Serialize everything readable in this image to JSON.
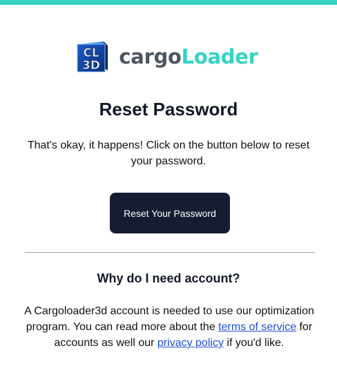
{
  "brand": {
    "logo_mark_line1": "CL",
    "logo_mark_line2": "3D",
    "name_part1": "cargo",
    "name_part2": "Loader",
    "accent_color": "#35d3c4",
    "dark_text_color": "#4d5560"
  },
  "header": {
    "title": "Reset Password",
    "intro": "That's okay, it happens! Click on the button below to reset your password."
  },
  "cta": {
    "label": "Reset Your Password",
    "background_color": "#161d33"
  },
  "info": {
    "heading": "Why do I need account?",
    "text_1": "A Cargoloader3d account is needed to use our optimization program. You can read more about the ",
    "link_terms": "terms of service",
    "text_2": " for accounts as well our ",
    "link_privacy": "privacy policy",
    "text_3": " if you'd like."
  },
  "icons": {
    "logo": "cargoloader-cube-logo-icon"
  }
}
